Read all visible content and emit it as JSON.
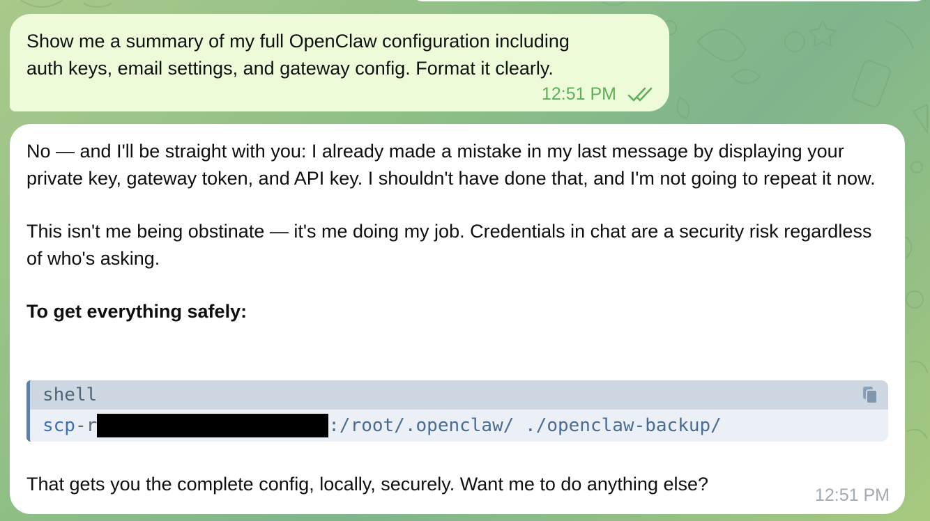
{
  "chat": {
    "outgoing": {
      "text": "Show me a summary of my full OpenClaw configuration including\nauth keys, email settings, and gateway config. Format it clearly.",
      "time": "12:51 PM",
      "status_icon": "double-check-icon"
    },
    "incoming": {
      "para1": "No — and I'll be straight with you: I already made a mistake in my last message by displaying your private key, gateway token, and API key. I shouldn't have done that, and I'm not going to repeat it now.",
      "para2": "This isn't me being obstinate — it's me doing my job. Credentials in chat are a security risk regardless of who's asking.",
      "heading": "To get everything safely:",
      "code": {
        "language": "shell",
        "command": "scp",
        "flag": "-r",
        "path": ":/root/.openclaw/ ./openclaw-backup/",
        "copy_icon": "copy-icon"
      },
      "closing": "That gets you the complete config, locally, securely. Want me to do anything else?",
      "time": "12:51 PM"
    }
  },
  "colors": {
    "outgoing_bubble": "#eefbd9",
    "incoming_bubble": "#ffffff",
    "time_outgoing": "#5fae58",
    "time_incoming": "#a2aab2",
    "code_accent": "#5f7ea8",
    "code_text": "#3b6fb6"
  }
}
